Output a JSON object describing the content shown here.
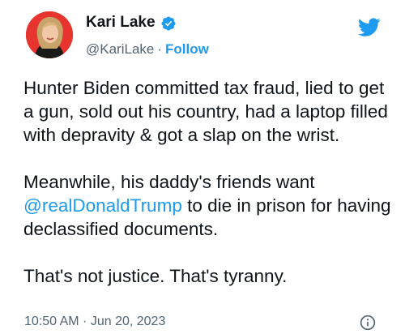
{
  "author": {
    "name": "Kari Lake",
    "handle": "@KariLake",
    "separator": "·",
    "follow_label": "Follow"
  },
  "tweet": {
    "paragraph1": "Hunter Biden committed tax fraud, lied to get a gun, sold out his country, had a laptop filled with depravity & got a slap on the wrist.",
    "paragraph2_before": "Meanwhile, his daddy's friends want ",
    "paragraph2_mention": "@realDonaldTrump",
    "paragraph2_after": " to die in prison for having declassified documents.",
    "paragraph3": "That's not justice. That's tyranny."
  },
  "footer": {
    "timestamp": "10:50 AM · Jun 20, 2023"
  },
  "icons": {
    "verified": "verified-badge-icon",
    "brand": "twitter-bird-icon",
    "info": "info-icon"
  },
  "colors": {
    "accent": "#1d9bf0",
    "text": "#0f1419",
    "secondary": "#536471",
    "avatar_bg": "#e8342e"
  }
}
